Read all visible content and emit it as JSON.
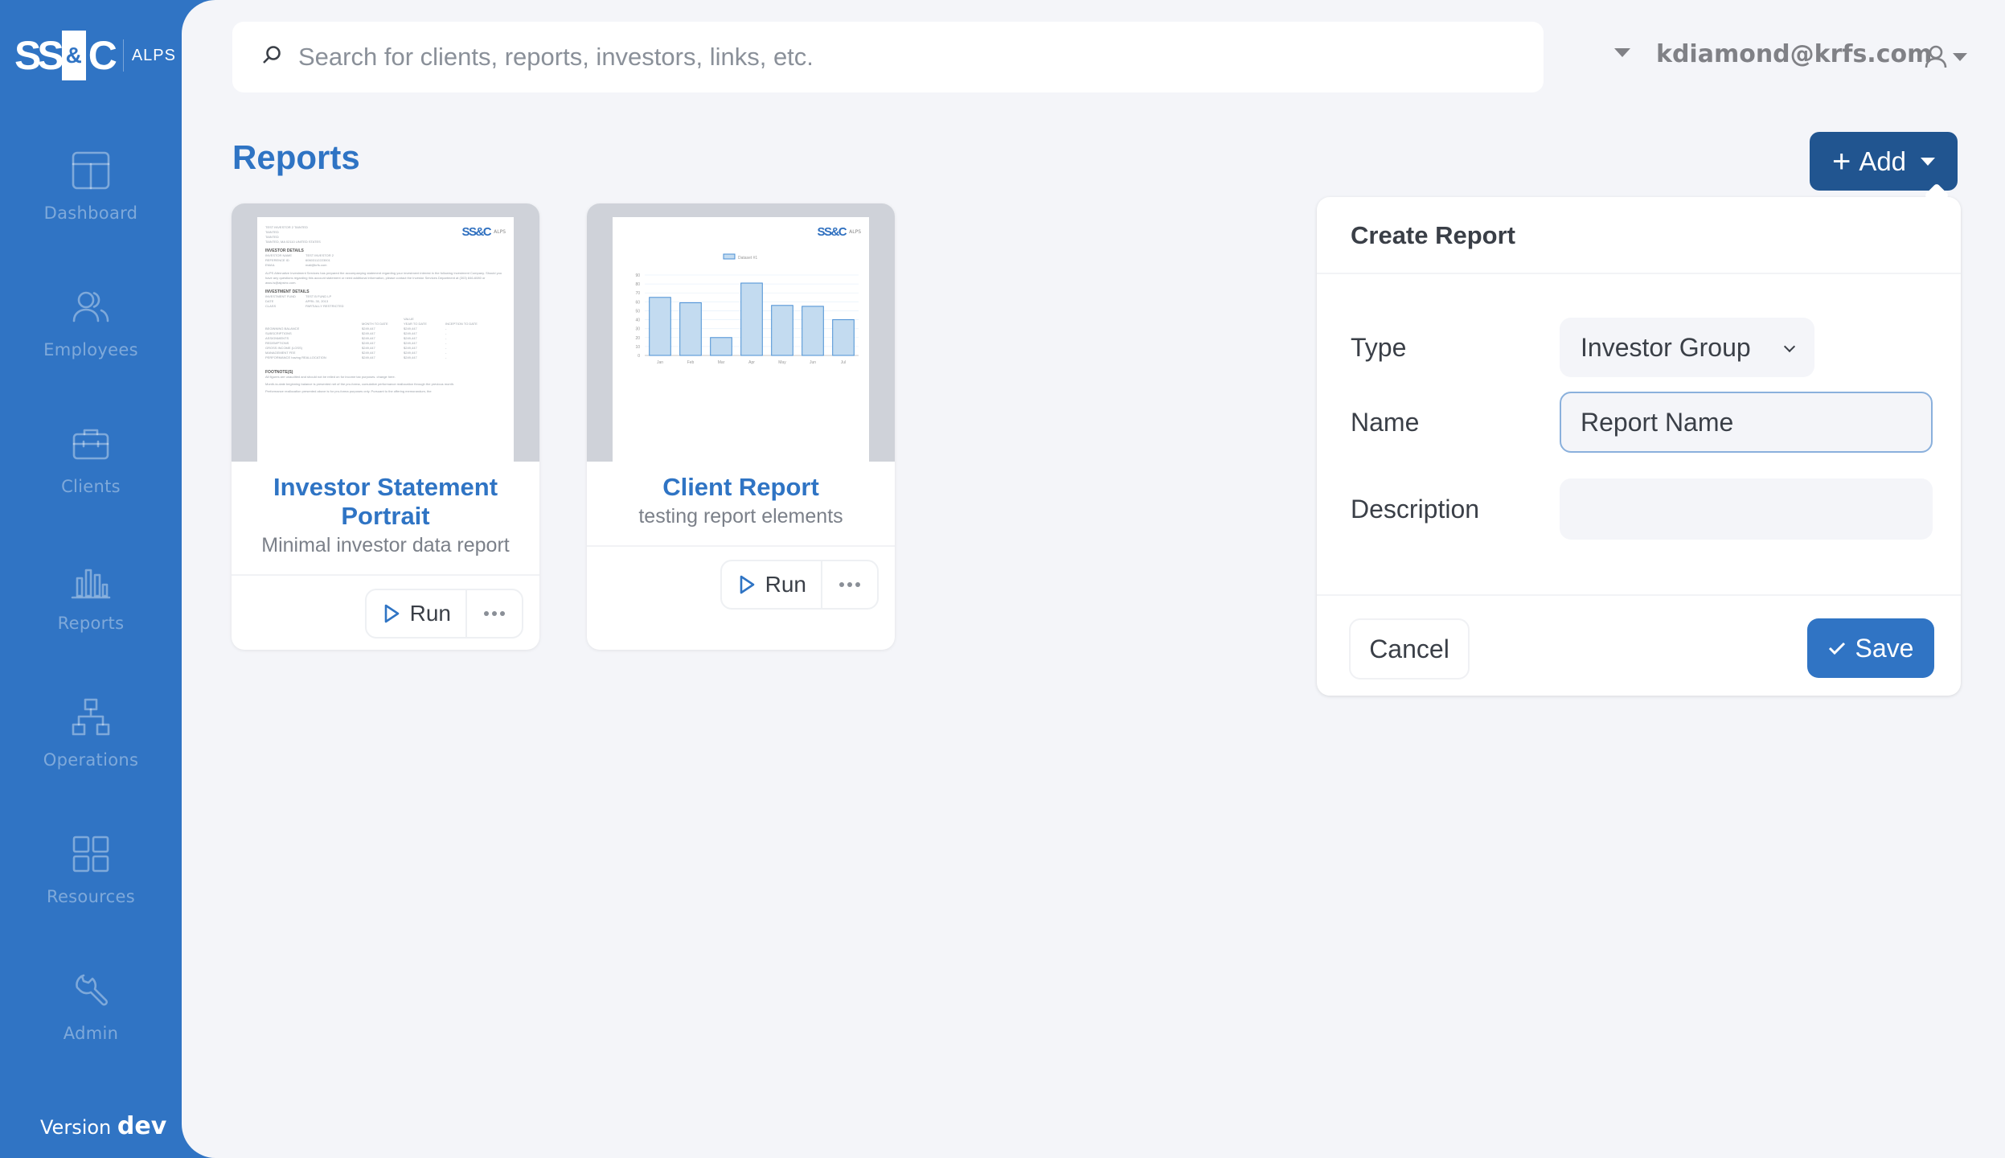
{
  "brand": {
    "logo_left": "SS",
    "logo_amp": "&",
    "logo_right": "C",
    "product": "ALPS"
  },
  "sidebar": {
    "items": [
      {
        "label": "Dashboard",
        "icon": "layout-icon"
      },
      {
        "label": "Employees",
        "icon": "users-icon"
      },
      {
        "label": "Clients",
        "icon": "briefcase-icon"
      },
      {
        "label": "Reports",
        "icon": "bar-chart-icon"
      },
      {
        "label": "Operations",
        "icon": "org-chart-icon"
      },
      {
        "label": "Resources",
        "icon": "grid-icon"
      },
      {
        "label": "Admin",
        "icon": "wrench-icon"
      }
    ],
    "version_label": "Version",
    "version_value": "dev"
  },
  "header": {
    "search_placeholder": "Search for clients, reports, investors, links, etc.",
    "user_email": "kdiamond@krfs.com"
  },
  "main": {
    "title": "Reports",
    "add_button": "Add",
    "cards": [
      {
        "title": "Investor Statement Portrait",
        "description": "Minimal investor data report",
        "run_label": "Run",
        "thumbnail": {
          "address": [
            "TEST INVESTOR 2 TAINTED",
            "TAINTED",
            "TAINTED",
            "TAINTED, MA 02110 UNITED STATES"
          ],
          "investor_heading": "INVESTOR DETAILS",
          "investor_rows": [
            [
              "INVESTOR NAME",
              "TEST INVESTOR 2"
            ],
            [
              "REFERENCE ID",
              "60603112223001"
            ],
            [
              "EMAIL",
              "mail@krfs.com"
            ]
          ],
          "intro": "ALPS Alternative Investment Services has prepared the accompanying statement regarding your investment interest in the following Investment Company. Should you have any questions regarding this account statement or need additional information, please contact the Investor Services Department at (303) 846-6080 or asss.is@alpsinc.com.",
          "investment_heading": "INVESTMENT DETAILS",
          "investment_rows": [
            [
              "INVESTMENT FUND",
              "TEST B FUND LP"
            ],
            [
              "DATE",
              "APRIL 30, 2013"
            ],
            [
              "CLASS",
              "PARTIALLY RESTRICTED"
            ]
          ],
          "value_header": "VALUE",
          "columns": [
            "MONTH TO DATE",
            "YEAR TO DATE",
            "INCEPTION TO DATE"
          ],
          "value_rows": [
            [
              "BEGINNING BALANCE",
              "$249,447",
              "$249,447",
              "-"
            ],
            [
              "SUBSCRIPTIONS",
              "$249,447",
              "$249,447",
              "-"
            ],
            [
              "ASSIGNMENTS",
              "$249,447",
              "$249,447",
              "-"
            ],
            [
              "REDEMPTIONS",
              "$249,447",
              "$249,447",
              "-"
            ],
            [
              "GROSS INCOME (LOSS)",
              "$249,447",
              "$249,447",
              "-"
            ],
            [
              "MANAGEMENT FEE",
              "$249,447",
              "$249,447",
              "-"
            ],
            [
              "PERFORMANCE having REALLOCATION",
              "$249,447",
              "$249,447",
              "-"
            ]
          ],
          "footnote_heading": "FOOTNOTE(S)",
          "footnotes": [
            "All figures are unaudited and should not be relied on for income tax purposes. change here.",
            "Month-to-date beginning balance is presented net of the pro-forma, cumulative performance reallocation through the previous month.",
            "Performance reallocation presented above is for pro-forma purposes only. Pursuant to the offering memorandum, the"
          ]
        }
      },
      {
        "title": "Client Report",
        "description": "testing report elements",
        "run_label": "Run"
      }
    ]
  },
  "chart_data": {
    "type": "bar",
    "title": "",
    "legend": [
      "Dataset #1"
    ],
    "legend_position": "top",
    "categories": [
      "Jan",
      "Feb",
      "Mar",
      "Apr",
      "May",
      "Jun",
      "Jul"
    ],
    "series": [
      {
        "name": "Dataset #1",
        "values": [
          65,
          59,
          20,
          81,
          56,
          55,
          40
        ]
      }
    ],
    "yticks": [
      0,
      10,
      20,
      30,
      40,
      50,
      60,
      70,
      80,
      90
    ],
    "ylim": [
      0,
      90
    ],
    "xlabel": "",
    "ylabel": "",
    "grid": true,
    "colors": {
      "fill": "#c3dbf0",
      "stroke": "#4a8fd4"
    }
  },
  "create_report": {
    "title": "Create Report",
    "type_label": "Type",
    "type_value": "Investor Group",
    "name_label": "Name",
    "name_value": "Report Name",
    "description_label": "Description",
    "description_value": "",
    "cancel_label": "Cancel",
    "save_label": "Save"
  },
  "colors": {
    "sidebar": "#3074c4",
    "main_bg": "#f4f5f9",
    "accent": "#2f74c4",
    "add_button": "#215590",
    "text_dark": "#3a3f47",
    "text_muted": "#808186"
  }
}
